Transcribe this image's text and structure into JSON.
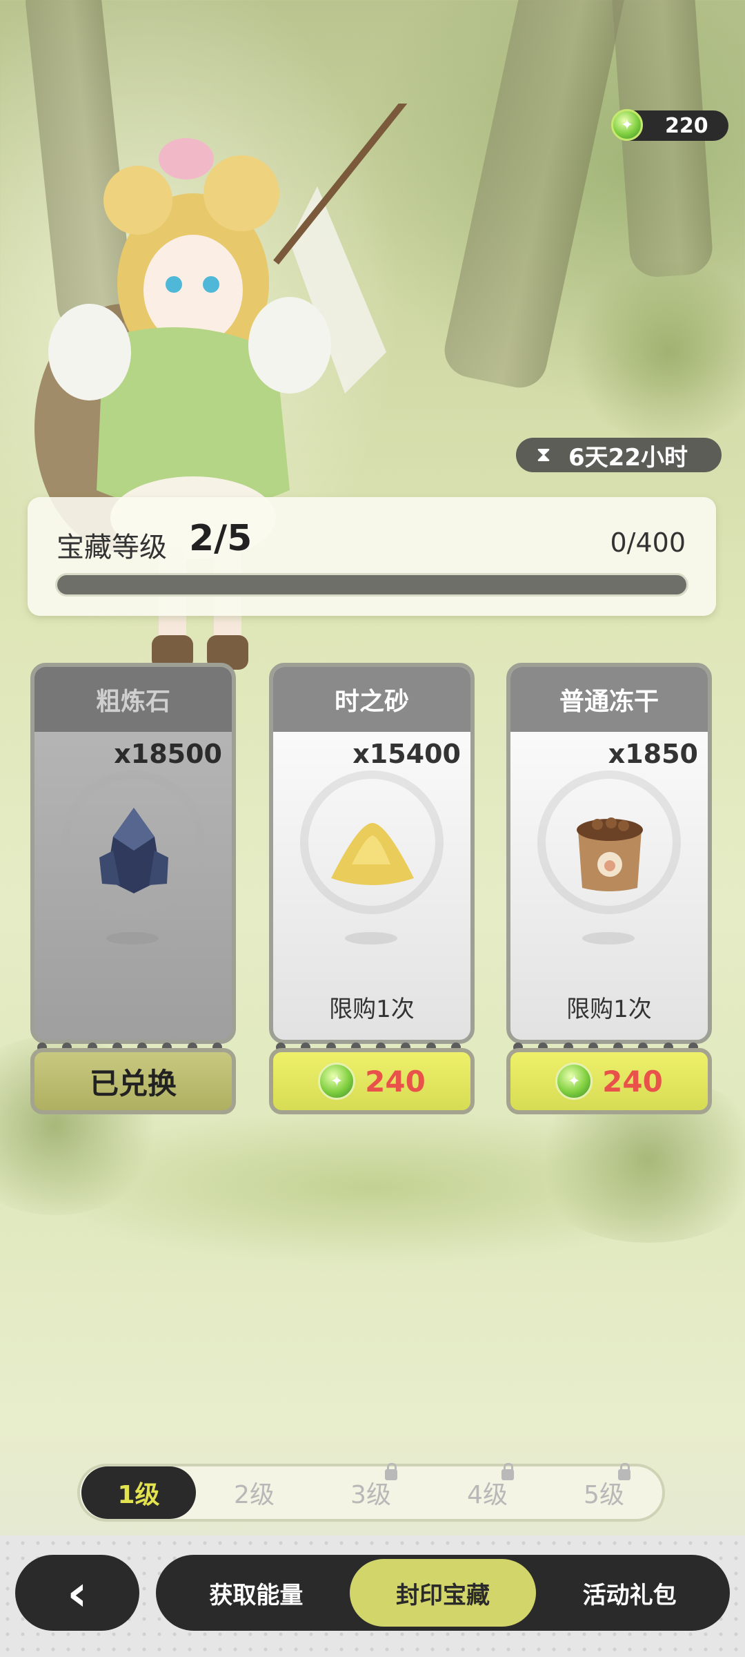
{
  "currency": {
    "amount": "220",
    "icon": "leaf-gem-icon"
  },
  "timer": {
    "icon": "hourglass-icon",
    "text": "6天22小时"
  },
  "treasure": {
    "label": "宝藏等级",
    "level": "2/5",
    "progress_text": "0/400",
    "progress_fraction": 0
  },
  "cards": [
    {
      "name": "粗炼石",
      "quantity": "x18500",
      "icon": "ore-crystal-icon",
      "state": "redeemed",
      "button_label": "已兑换",
      "limit": ""
    },
    {
      "name": "时之砂",
      "quantity": "x15400",
      "icon": "sand-pile-icon",
      "state": "available",
      "limit": "限购1次",
      "price": "240"
    },
    {
      "name": "普通冻干",
      "quantity": "x1850",
      "icon": "food-bag-icon",
      "state": "available",
      "limit": "限购1次",
      "price": "240"
    }
  ],
  "level_tabs": [
    {
      "label": "1级",
      "active": true,
      "locked": false
    },
    {
      "label": "2级",
      "active": false,
      "locked": false
    },
    {
      "label": "3级",
      "active": false,
      "locked": true
    },
    {
      "label": "4级",
      "active": false,
      "locked": true
    },
    {
      "label": "5级",
      "active": false,
      "locked": true
    }
  ],
  "bottom_nav": {
    "back_icon": "chevron-left-icon",
    "items": [
      {
        "label": "获取能量",
        "active": false
      },
      {
        "label": "封印宝藏",
        "active": true
      },
      {
        "label": "活动礼包",
        "active": false
      }
    ]
  },
  "colors": {
    "accent": "#d2d56a",
    "price": "#e8524a",
    "dark": "#2a2a2a"
  }
}
